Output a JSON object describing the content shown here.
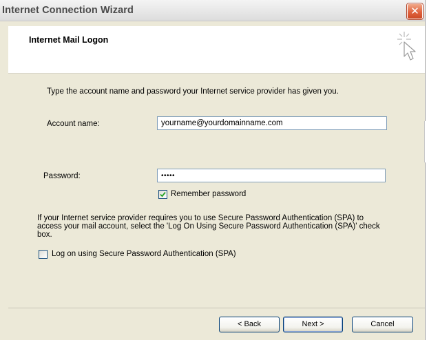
{
  "window": {
    "title": "Internet Connection Wizard",
    "close_label": "✕"
  },
  "header": {
    "title": "Internet Mail Logon",
    "icon": "wizard-cursor-icon"
  },
  "instruction": "Type the account name and password your Internet service provider has given you.",
  "account": {
    "label": "Account name:",
    "value": "yourname@yourdomainname.com"
  },
  "password": {
    "label": "Password:",
    "value": "•••••"
  },
  "remember": {
    "label": "Remember password",
    "checked": true
  },
  "spa_text": "If your Internet service provider requires you to use Secure Password Authentication (SPA) to access your mail account, select the 'Log On Using Secure Password Authentication (SPA)' check box.",
  "spa": {
    "label": "Log on using Secure Password Authentication (SPA)",
    "checked": false
  },
  "buttons": {
    "back": "< Back",
    "next": "Next >",
    "cancel": "Cancel"
  }
}
